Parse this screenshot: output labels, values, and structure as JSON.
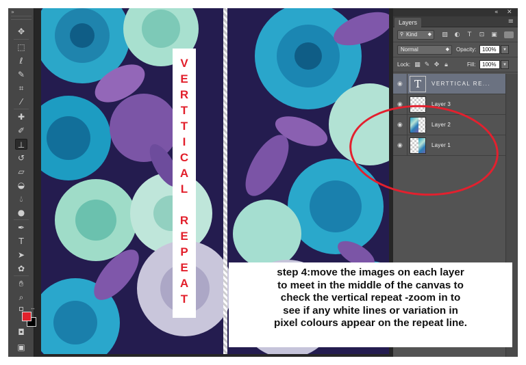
{
  "canvas_label": {
    "letters": [
      "V",
      "E",
      "R",
      "T",
      "T",
      "I",
      "C",
      "A",
      "L",
      "",
      "R",
      "E",
      "P",
      "E",
      "A",
      "T"
    ]
  },
  "layers_panel": {
    "tab": "Layers",
    "filter_kind": "Kind",
    "blend_mode": "Normal",
    "opacity_label": "Opacity:",
    "opacity_value": "100%",
    "lock_label": "Lock:",
    "fill_label": "Fill:",
    "fill_value": "100%",
    "layers": [
      {
        "name": "VERTTICAL RE...",
        "type": "text",
        "selected": true
      },
      {
        "name": "Layer 3",
        "type": "empty",
        "selected": false
      },
      {
        "name": "Layer 2",
        "type": "pattern",
        "selected": false
      },
      {
        "name": "Layer 1",
        "type": "pattern",
        "selected": false
      }
    ]
  },
  "caption": {
    "text": "step 4:move the images on each layer\nto meet in the middle of the canvas to\ncheck the vertical repeat -zoom in to\nsee if any white lines  or variation in\npixel colours appear on the repeat line."
  },
  "colors": {
    "foreground": "#e0222c",
    "background": "#000000",
    "annotation": "#e3202e",
    "label_text": "#e21f2b"
  },
  "toolbar": {
    "tools": [
      "move-tool",
      "marquee-tool",
      "lasso-tool",
      "quick-select-tool",
      "crop-tool",
      "eyedropper-tool",
      "healing-brush-tool",
      "brush-tool",
      "clone-stamp-tool",
      "history-brush-tool",
      "eraser-tool",
      "paint-bucket-tool",
      "blur-tool",
      "dodge-tool",
      "pen-tool",
      "type-tool",
      "path-selection-tool",
      "custom-shape-tool",
      "hand-tool",
      "zoom-tool"
    ],
    "active_tool": "clone-stamp-tool"
  }
}
